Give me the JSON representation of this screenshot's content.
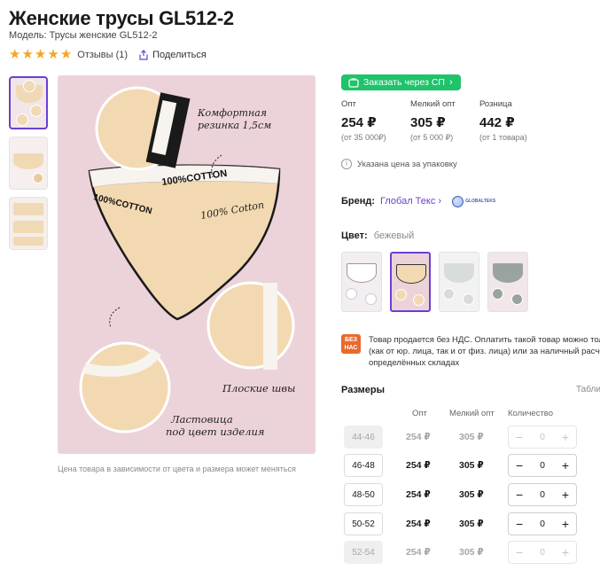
{
  "product": {
    "title": "Женские трусы GL512-2",
    "model": "Модель: Трусы женские GL512-2",
    "reviews": "Отзывы (1)",
    "share": "Поделиться",
    "rating_stars": 5
  },
  "image": {
    "callout_top": "Комфортная резинка 1,5см",
    "waistband_text": "100%COTTON",
    "body_text": "100% Cotton",
    "callout_seams": "Плоские швы",
    "callout_gusset": "Ластовица под цвет изделия",
    "caption": "Цена товара в зависимости от цвета и размера может меняться"
  },
  "order_button": "Заказать через СП",
  "prices": [
    {
      "label": "Опт",
      "value": "254 ₽",
      "note": "(от 35 000₽)"
    },
    {
      "label": "Мелкий опт",
      "value": "305 ₽",
      "note": "(от 5 000 ₽)"
    },
    {
      "label": "Розница",
      "value": "442 ₽",
      "note": "(от 1 товара)"
    }
  ],
  "pack_note": "Указана цена за упаковку",
  "brand": {
    "label": "Бренд:",
    "name": "Глобал Текс",
    "logo_text": "GLOBALTEKS"
  },
  "color": {
    "label": "Цвет:",
    "value": "бежевый"
  },
  "vat": {
    "badge": "БЕЗ НАС",
    "line1": "Товар продается без НДС. Оплатить такой товар можно толь",
    "line2": "(как от юр. лица, так и от физ. лица) или за наличный расчёт",
    "line3": "определённых складах"
  },
  "sizes": {
    "title": "Размеры",
    "table_link": "Табли",
    "headers": {
      "opt": "Опт",
      "small_opt": "Мелкий опт",
      "qty": "Количество"
    },
    "rows": [
      {
        "size": "44-46",
        "opt": "254 ₽",
        "small_opt": "305 ₽",
        "qty": "0",
        "available": false
      },
      {
        "size": "46-48",
        "opt": "254 ₽",
        "small_opt": "305 ₽",
        "qty": "0",
        "available": true
      },
      {
        "size": "48-50",
        "opt": "254 ₽",
        "small_opt": "305 ₽",
        "qty": "0",
        "available": true
      },
      {
        "size": "50-52",
        "opt": "254 ₽",
        "small_opt": "305 ₽",
        "qty": "0",
        "available": true
      },
      {
        "size": "52-54",
        "opt": "254 ₽",
        "small_opt": "305 ₽",
        "qty": "0",
        "available": false
      }
    ]
  },
  "colors": {
    "accent": "#6a3fd1",
    "order_green": "#1ec36a",
    "star": "#f5a623",
    "vat_badge": "#e86a2f"
  }
}
